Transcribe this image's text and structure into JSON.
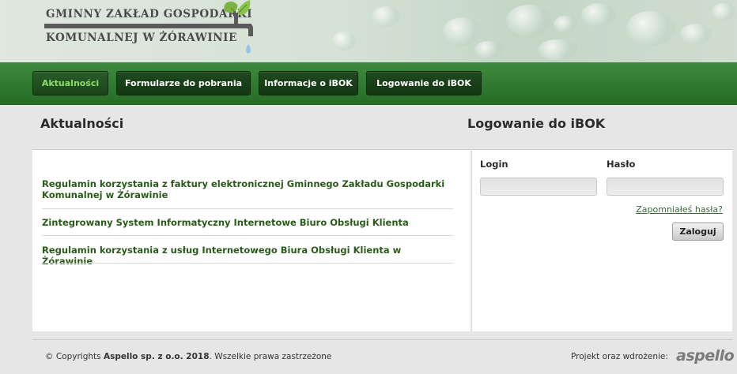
{
  "header": {
    "logo_line1": "GMINNY ZAKŁAD GOSPODARKI",
    "logo_line2": "KOMUNALNEJ W ŻÓRAWINIE",
    "logo_icon": "tap-with-leaves-icon",
    "colors": {
      "leaf": "#7cb342",
      "pipe": "#5a5a5a",
      "drop": "#8ec7e8"
    }
  },
  "nav": {
    "items": [
      {
        "label": "Aktualności",
        "active": true
      },
      {
        "label": "Formularze do pobrania",
        "active": false
      },
      {
        "label": "Informacje o iBOK",
        "active": false
      },
      {
        "label": "Logowanie do iBOK",
        "active": false
      }
    ],
    "colors": {
      "bar": "#2f7a2f",
      "button": "#173d17",
      "active_text": "#8ddc6a"
    }
  },
  "news": {
    "title": "Aktualności",
    "items": [
      "Regulamin korzystania z faktury elektronicznej Gminnego Zakładu Gospodarki Komunalnej w Żórawinie",
      "Zintegrowany System Informatyczny Internetowe Biuro Obsługi Klienta",
      "Regulamin korzystania z usług Internetowego Biura Obsługi Klienta w Żórawinie"
    ],
    "link_color": "#2a5a1a"
  },
  "login": {
    "title": "Logowanie do iBOK",
    "login_label": "Login",
    "login_value": "",
    "password_label": "Hasło",
    "password_value": "",
    "forgot_label": "Zapomniałeś hasła?",
    "submit_label": "Zaloguj"
  },
  "footer": {
    "copyright_prefix": "© Copyrights",
    "copyright_company": "Aspello sp. z o.o. 2018",
    "copyright_suffix": ". Wszelkie prawa zastrzeżone",
    "project_label": "Projekt oraz wdrożenie:",
    "brand": "aspello",
    "brand_dot_color": "#cc2a1a"
  }
}
